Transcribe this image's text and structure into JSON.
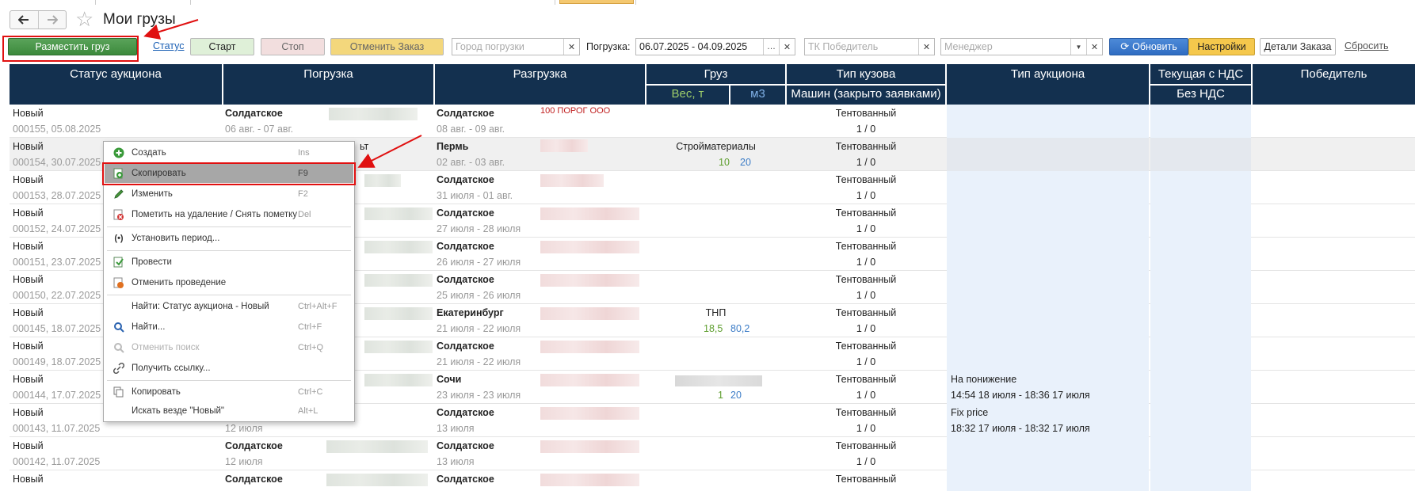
{
  "title": "Мои грузы",
  "nav": {
    "back": "🡐",
    "forward": "🡒"
  },
  "toolbar": {
    "place_label": "Разместить груз",
    "status_link": "Статус",
    "start_label": "Старт",
    "stop_label": "Стоп",
    "cancel_label": "Отменить Заказ",
    "city_placeholder": "Город погрузки",
    "loading_label": "Погрузка:",
    "period_value": "06.07.2025 - 04.09.2025",
    "tk_placeholder": "ТК Победитель",
    "manager_placeholder": "Менеджер",
    "refresh_label": "Обновить",
    "settings_label": "Настройки",
    "details_label": "Детали Заказа",
    "reset_label": "Сбросить"
  },
  "headers": {
    "status": "Статус аукциона",
    "loading": "Погрузка",
    "unloading": "Разгрузка",
    "cargo": "Груз",
    "weight": "Вес, т",
    "volume": "м3",
    "body_type": "Тип кузова",
    "trucks": "Машин (закрыто заявками)",
    "auction_type": "Тип аукциона",
    "vat": "Текущая с НДС",
    "no_vat": "Без НДС",
    "winner": "Победитель"
  },
  "rows": [
    {
      "status": "Новый",
      "id": "000155, 05.08.2025",
      "load_city": "Солдатское",
      "load_dates": "06 авг. - 07 авг.",
      "unload_city": "Солдатское",
      "unload_dates": "08 авг. - 09 авг.",
      "cargo": "",
      "weight": "",
      "volume": "",
      "body": "Тентованный",
      "trucks": "1 / 0",
      "auction": "",
      "auction_time": ""
    },
    {
      "status": "Новый",
      "id": "000154, 30.07.2025",
      "load_city": "",
      "load_dates": "",
      "unload_city": "Пермь",
      "unload_dates": "02 авг. - 03 авг.",
      "cargo": "Стройматериалы",
      "weight": "10",
      "volume": "20",
      "body": "Тентованный",
      "trucks": "1 / 0",
      "auction": "",
      "auction_time": ""
    },
    {
      "status": "Новый",
      "id": "000153, 28.07.2025",
      "load_city": "",
      "load_dates": "",
      "unload_city": "Солдатское",
      "unload_dates": "31 июля - 01 авг.",
      "cargo": "",
      "weight": "",
      "volume": "",
      "body": "Тентованный",
      "trucks": "1 / 0",
      "auction": "",
      "auction_time": ""
    },
    {
      "status": "Новый",
      "id": "000152, 24.07.2025",
      "load_city": "",
      "load_dates": "",
      "unload_city": "Солдатское",
      "unload_dates": "27 июля - 28 июля",
      "cargo": "",
      "weight": "",
      "volume": "",
      "body": "Тентованный",
      "trucks": "1 / 0",
      "auction": "",
      "auction_time": ""
    },
    {
      "status": "Новый",
      "id": "000151, 23.07.2025",
      "load_city": "",
      "load_dates": "",
      "unload_city": "Солдатское",
      "unload_dates": "26 июля - 27 июля",
      "cargo": "",
      "weight": "",
      "volume": "",
      "body": "Тентованный",
      "trucks": "1 / 0",
      "auction": "",
      "auction_time": ""
    },
    {
      "status": "Новый",
      "id": "000150, 22.07.2025",
      "load_city": "",
      "load_dates": "",
      "unload_city": "Солдатское",
      "unload_dates": "25 июля - 26 июля",
      "cargo": "",
      "weight": "",
      "volume": "",
      "body": "Тентованный",
      "trucks": "1 / 0",
      "auction": "",
      "auction_time": ""
    },
    {
      "status": "Новый",
      "id": "000145, 18.07.2025",
      "load_city": "",
      "load_dates": "",
      "unload_city": "Екатеринбург",
      "unload_dates": "21 июля - 22 июля",
      "cargo": "ТНП",
      "weight": "18,5",
      "volume": "80,2",
      "body": "Тентованный",
      "trucks": "1 / 0",
      "auction": "",
      "auction_time": ""
    },
    {
      "status": "Новый",
      "id": "000149, 18.07.2025",
      "load_city": "",
      "load_dates": "",
      "unload_city": "Солдатское",
      "unload_dates": "21 июля - 22 июля",
      "cargo": "",
      "weight": "",
      "volume": "",
      "body": "Тентованный",
      "trucks": "1 / 0",
      "auction": "",
      "auction_time": ""
    },
    {
      "status": "Новый",
      "id": "000144, 17.07.2025",
      "load_city": "",
      "load_dates": "",
      "unload_city": "Сочи",
      "unload_dates": "23 июля - 23 июля",
      "cargo": "",
      "weight": "1",
      "volume": "20",
      "body": "Тентованный",
      "trucks": "1 / 0",
      "auction": "На понижение",
      "auction_time": "14:54 18 июля - 18:36 17 июля"
    },
    {
      "status": "Новый",
      "id": "000143, 11.07.2025",
      "load_city": "",
      "load_dates": "12 июля",
      "unload_city": "Солдатское",
      "unload_dates": "13 июля",
      "cargo": "",
      "weight": "",
      "volume": "",
      "body": "Тентованный",
      "trucks": "1 / 0",
      "auction": "Fix price",
      "auction_time": "18:32 17 июля - 18:32 17 июля"
    },
    {
      "status": "Новый",
      "id": "000142, 11.07.2025",
      "load_city": "Солдатское",
      "load_dates": "12 июля",
      "unload_city": "Солдатское",
      "unload_dates": "13 июля",
      "cargo": "",
      "weight": "",
      "volume": "",
      "body": "Тентованный",
      "trucks": "1 / 0",
      "auction": "",
      "auction_time": ""
    },
    {
      "status": "Новый",
      "id": "",
      "load_city": "Солдатское",
      "load_dates": "",
      "unload_city": "Солдатское",
      "unload_dates": "",
      "cargo": "",
      "weight": "",
      "volume": "",
      "body": "Тентованный",
      "trucks": "",
      "auction": "",
      "auction_time": ""
    }
  ],
  "context_menu": [
    {
      "label": "Создать",
      "shortcut": "Ins",
      "icon": "plus-icon"
    },
    {
      "label": "Скопировать",
      "shortcut": "F9",
      "icon": "copy-plus-icon"
    },
    {
      "label": "Изменить",
      "shortcut": "F2",
      "icon": "pencil-icon"
    },
    {
      "label": "Пометить на удаление / Снять пометку",
      "shortcut": "Del",
      "icon": "delete-mark-icon"
    },
    {
      "label": "Установить период...",
      "shortcut": "",
      "icon": "period-icon"
    },
    {
      "label": "Провести",
      "shortcut": "",
      "icon": "post-icon"
    },
    {
      "label": "Отменить проведение",
      "shortcut": "",
      "icon": "unpost-icon"
    },
    {
      "label": "Найти: Статус аукциона - Новый",
      "shortcut": "Ctrl+Alt+F",
      "icon": ""
    },
    {
      "label": "Найти...",
      "shortcut": "Ctrl+F",
      "icon": "search-icon"
    },
    {
      "label": "Отменить поиск",
      "shortcut": "Ctrl+Q",
      "icon": "cancel-search-icon"
    },
    {
      "label": "Получить ссылку...",
      "shortcut": "",
      "icon": "link-icon"
    },
    {
      "label": "Копировать",
      "shortcut": "Ctrl+C",
      "icon": "copy-icon"
    },
    {
      "label": "Искать везде \"Новый\"",
      "shortcut": "Alt+L",
      "icon": ""
    }
  ],
  "partial_text": {
    "row1_unload_extra": "100 ПОРОГ ООО",
    "row2_load_extra": "ьт"
  }
}
